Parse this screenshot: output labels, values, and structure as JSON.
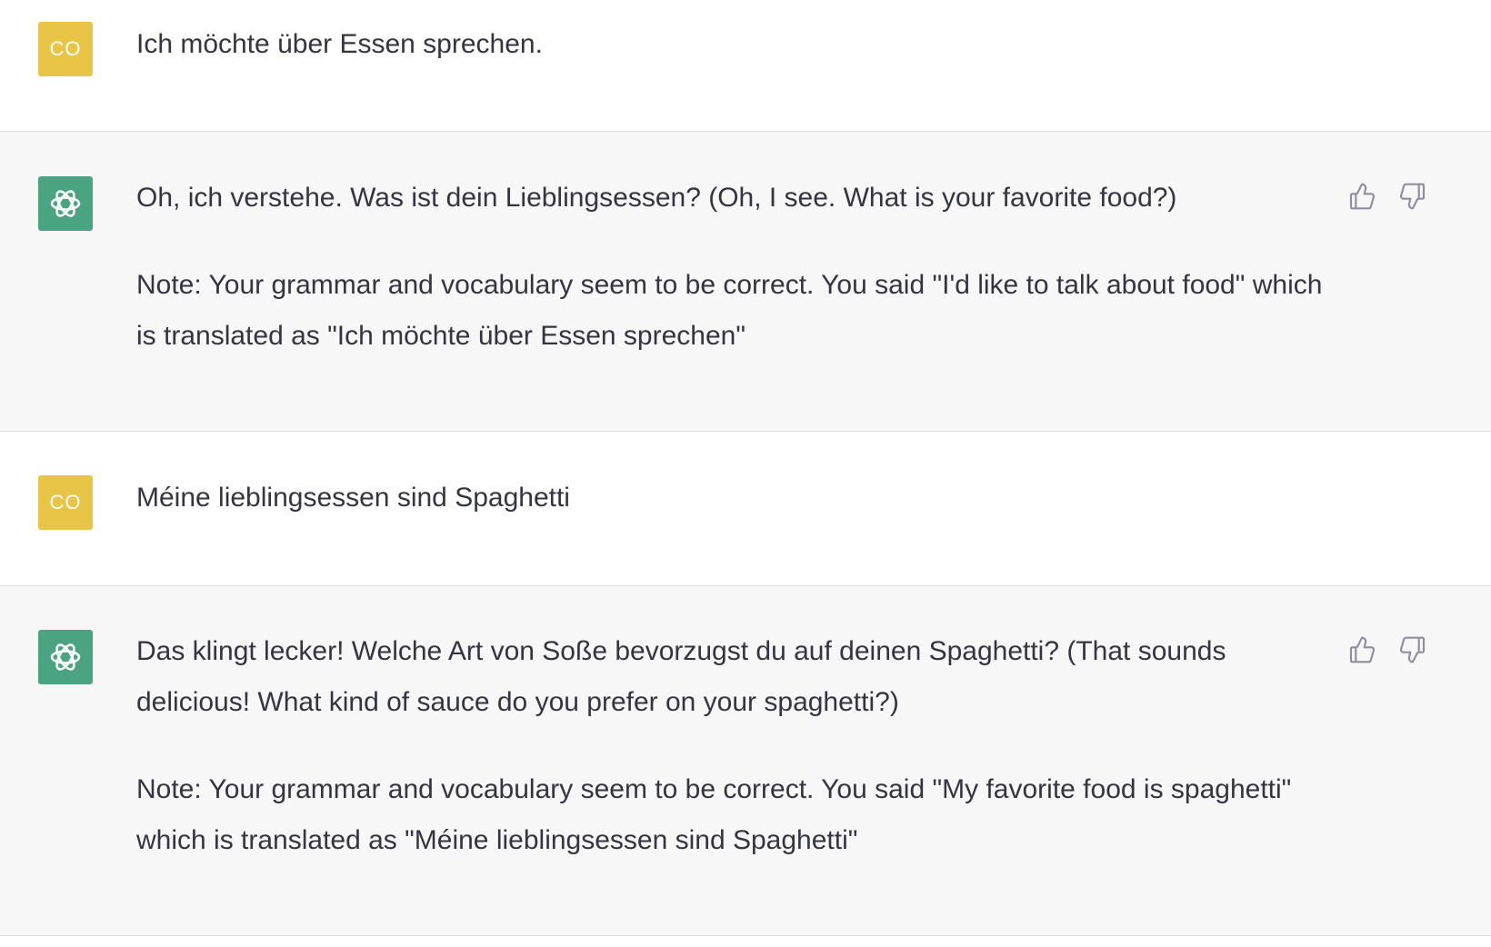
{
  "user": {
    "avatar_initials": "CO",
    "avatar_color": "#e8c547"
  },
  "assistant": {
    "avatar_icon": "openai-logo-icon",
    "avatar_color": "#4aa381"
  },
  "messages": [
    {
      "role": "user",
      "paragraphs": [
        "Ich möchte über Essen sprechen."
      ]
    },
    {
      "role": "assistant",
      "paragraphs": [
        "Oh, ich verstehe. Was ist dein Lieblingsessen? (Oh, I see. What is your favorite food?)",
        "Note: Your grammar and vocabulary seem to be correct. You said \"I'd like to talk about food\" which is translated as \"Ich möchte über Essen sprechen\""
      ]
    },
    {
      "role": "user",
      "paragraphs": [
        "Méine lieblingsessen sind Spaghetti"
      ]
    },
    {
      "role": "assistant",
      "paragraphs": [
        "Das klingt lecker! Welche Art von Soße bevorzugst du auf deinen Spaghetti? (That sounds delicious! What kind of sauce do you prefer on your spaghetti?)",
        "Note: Your grammar and vocabulary seem to be correct. You said \"My favorite food is spaghetti\" which is translated as \"Méine lieblingsessen sind Spaghetti\""
      ]
    }
  ]
}
